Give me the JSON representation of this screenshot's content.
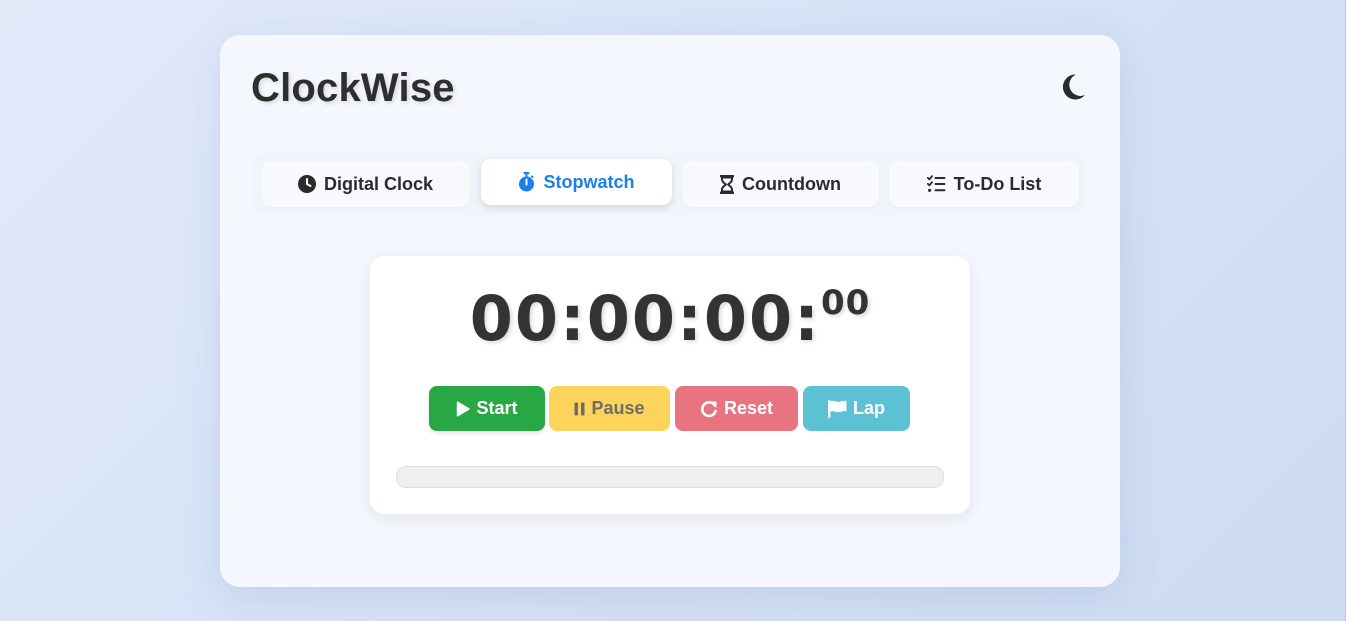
{
  "app": {
    "title": "ClockWise",
    "theme_toggle_icon": "moon-icon"
  },
  "tabs": [
    {
      "label": "Digital Clock",
      "icon": "clock-icon",
      "active": false
    },
    {
      "label": "Stopwatch",
      "icon": "stopwatch-icon",
      "active": true
    },
    {
      "label": "Countdown",
      "icon": "hourglass-icon",
      "active": false
    },
    {
      "label": "To-Do List",
      "icon": "checklist-icon",
      "active": false
    }
  ],
  "stopwatch": {
    "time_main": "00:00:00:",
    "time_ms": "00",
    "progress": 0,
    "buttons": {
      "start": {
        "label": "Start",
        "icon": "play-icon",
        "color": "#28a745"
      },
      "pause": {
        "label": "Pause",
        "icon": "pause-icon",
        "color": "#fcd45a"
      },
      "reset": {
        "label": "Reset",
        "icon": "redo-icon",
        "color": "#e87480"
      },
      "lap": {
        "label": "Lap",
        "icon": "flag-icon",
        "color": "#5bc1d3"
      }
    }
  },
  "colors": {
    "accent": "#1a7fe8",
    "text": "#2e2e2e",
    "background": "#dce6f7"
  }
}
